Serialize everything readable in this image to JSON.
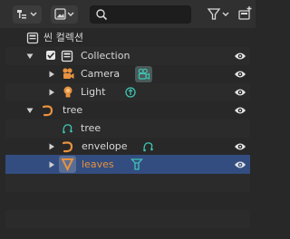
{
  "outliner": {
    "header": {
      "display_mode_icon": "outliner-display-mode-icon",
      "filter_icon": "filter-funnel-icon",
      "search": {
        "value": "",
        "placeholder": ""
      }
    },
    "scene_collection_label": "씬 컬렉션",
    "rows": [
      {
        "label": "Collection",
        "icon": "collection-icon"
      },
      {
        "label": "Camera",
        "icon": "camera-icon",
        "data_icon": "camera-data-icon"
      },
      {
        "label": "Light",
        "icon": "light-icon",
        "data_icon": "light-data-icon"
      },
      {
        "label": "tree",
        "icon": "curve-object-icon"
      },
      {
        "label": "tree",
        "icon": "curve-data-icon"
      },
      {
        "label": "envelope",
        "icon": "curve-object-icon",
        "data_icon": "curve-data-icon"
      },
      {
        "label": "leaves",
        "icon": "particle-object-icon",
        "data_icon": "particle-data-icon",
        "selected": true
      }
    ]
  },
  "colors": {
    "background": "#282828",
    "header": "#303030",
    "selected_row": "#334d80",
    "object_orange": "#e8923f",
    "data_teal": "#3fc6b4",
    "text": "#d8d8d8"
  }
}
